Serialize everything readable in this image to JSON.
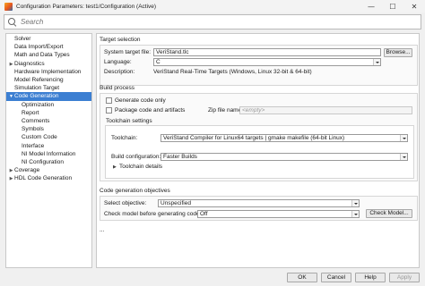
{
  "window": {
    "title": "Configuration Parameters: test1/Configuration (Active)",
    "controls": {
      "minimize": "—",
      "maximize": "☐",
      "close": "✕"
    }
  },
  "search": {
    "placeholder": "Search"
  },
  "tree": {
    "items": [
      {
        "label": "Solver",
        "arrow": ""
      },
      {
        "label": "Data Import/Export",
        "arrow": ""
      },
      {
        "label": "Math and Data Types",
        "arrow": ""
      },
      {
        "label": "Diagnostics",
        "arrow": "▶"
      },
      {
        "label": "Hardware Implementation",
        "arrow": ""
      },
      {
        "label": "Model Referencing",
        "arrow": ""
      },
      {
        "label": "Simulation Target",
        "arrow": ""
      },
      {
        "label": "Code Generation",
        "arrow": "▼"
      },
      {
        "label": "Optimization",
        "arrow": ""
      },
      {
        "label": "Report",
        "arrow": ""
      },
      {
        "label": "Comments",
        "arrow": ""
      },
      {
        "label": "Symbols",
        "arrow": ""
      },
      {
        "label": "Custom Code",
        "arrow": ""
      },
      {
        "label": "Interface",
        "arrow": ""
      },
      {
        "label": "NI Model Information",
        "arrow": ""
      },
      {
        "label": "NI Configuration",
        "arrow": ""
      },
      {
        "label": "Coverage",
        "arrow": "▶"
      },
      {
        "label": "HDL Code Generation",
        "arrow": "▶"
      }
    ],
    "selected": "Code Generation"
  },
  "target_selection": {
    "title": "Target selection",
    "system_target_label": "System target file:",
    "system_target_value": "VeriStand.tlc",
    "browse_label": "Browse...",
    "language_label": "Language:",
    "language_value": "C",
    "description_label": "Description:",
    "description_value": "VeriStand Real-Time Targets (Windows, Linux 32-bit & 64-bit)"
  },
  "build_process": {
    "title": "Build process",
    "generate_code_only": "Generate code only",
    "package_code": "Package code and artifacts",
    "zip_label": "Zip file name:",
    "zip_placeholder": "<empty>",
    "toolchain_settings_title": "Toolchain settings",
    "toolchain_label": "Toolchain:",
    "toolchain_value": "VeriStand Compiler for Linux64 targets | gmake makefile (64-bit Linux)",
    "build_config_label": "Build configuration:",
    "build_config_value": "Faster Builds",
    "toolchain_details": "Toolchain details",
    "toolchain_details_arrow": "▶"
  },
  "objectives": {
    "title": "Code generation objectives",
    "select_objective_label": "Select objective:",
    "select_objective_value": "Unspecified",
    "check_model_label": "Check model before generating code:",
    "check_model_value": "Off",
    "check_model_button": "Check Model..."
  },
  "ellipsis": "...",
  "footer": {
    "ok": "OK",
    "cancel": "Cancel",
    "help": "Help",
    "apply": "Apply"
  },
  "colors": {
    "selection": "#3c7fd2",
    "window_bg": "#f0f0f0"
  }
}
